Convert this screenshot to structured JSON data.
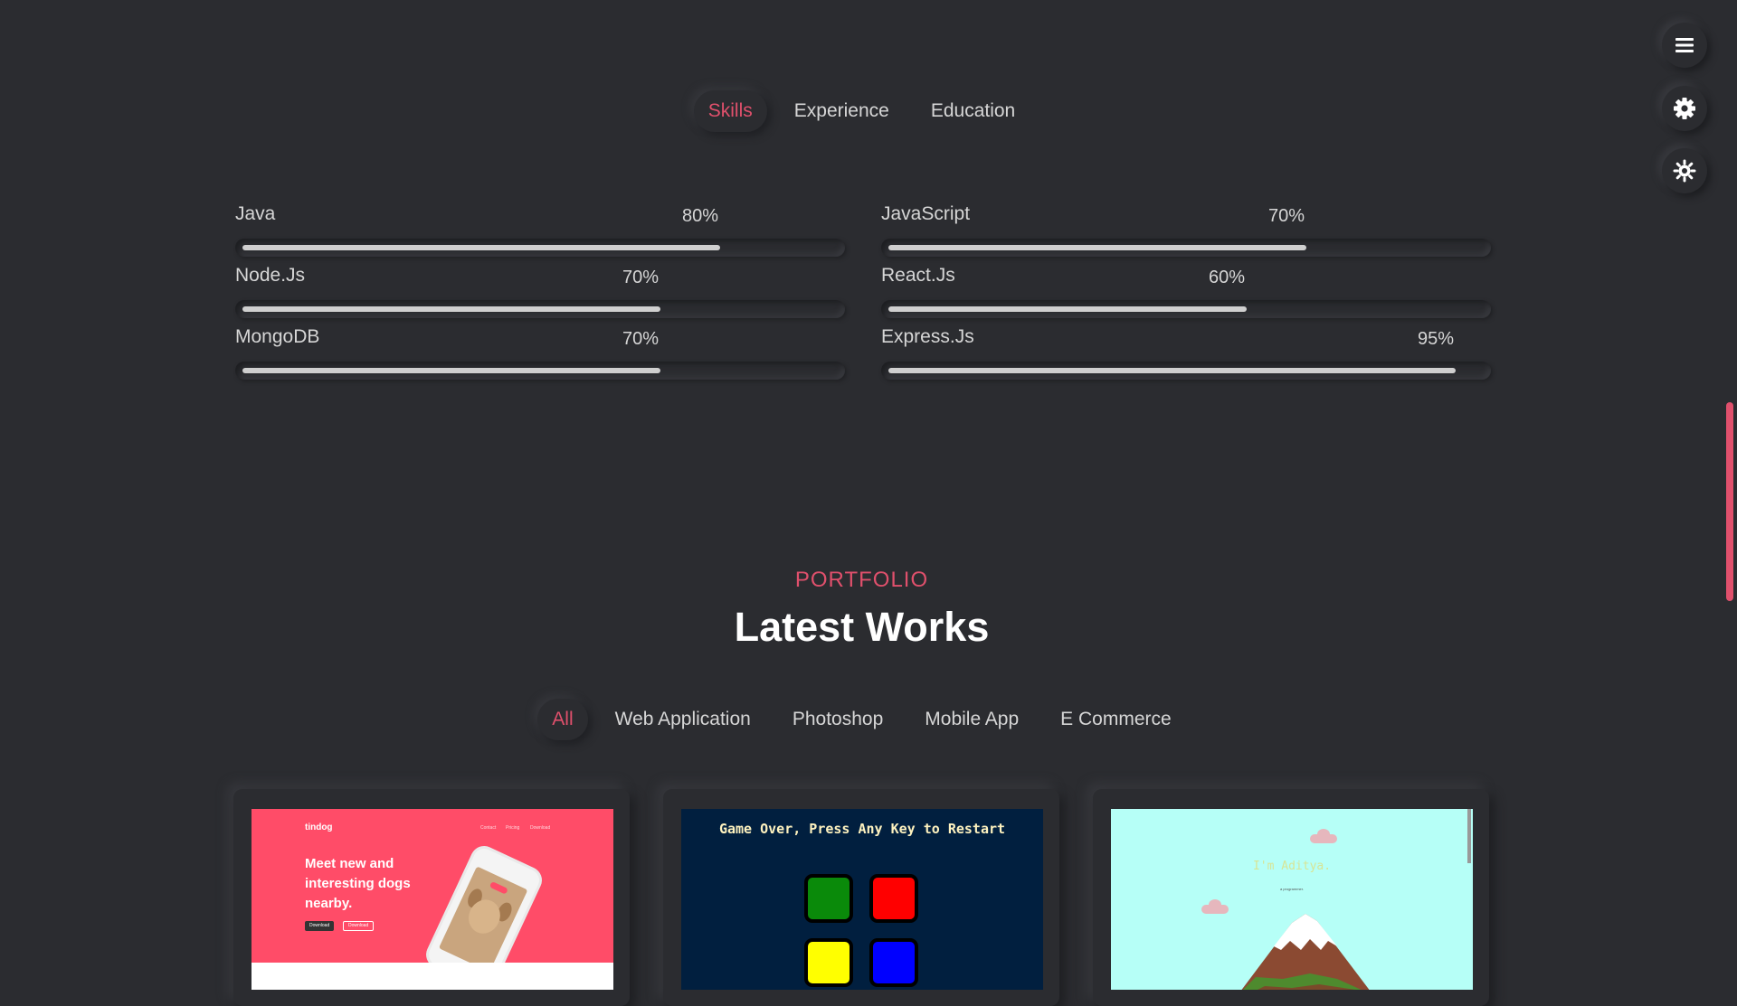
{
  "resume_tabs": [
    {
      "label": "Skills",
      "active": true
    },
    {
      "label": "Experience",
      "active": false
    },
    {
      "label": "Education",
      "active": false
    }
  ],
  "skills": [
    {
      "name": "Java",
      "percent_label": "80%",
      "level": 0.8
    },
    {
      "name": "JavaScript",
      "percent_label": "70%",
      "level": 0.7
    },
    {
      "name": "Node.Js",
      "percent_label": "70%",
      "level": 0.7
    },
    {
      "name": "React.Js",
      "percent_label": "60%",
      "level": 0.6
    },
    {
      "name": "MongoDB",
      "percent_label": "70%",
      "level": 0.7
    },
    {
      "name": "Express.Js",
      "percent_label": "95%",
      "level": 0.95
    }
  ],
  "portfolio": {
    "subtitle": "PORTFOLIO",
    "title": "Latest Works",
    "filters": [
      {
        "label": "All",
        "active": true
      },
      {
        "label": "Web Application",
        "active": false
      },
      {
        "label": "Photoshop",
        "active": false
      },
      {
        "label": "Mobile App",
        "active": false
      },
      {
        "label": "E Commerce",
        "active": false
      }
    ],
    "cards": [
      {
        "brand": "tindog",
        "nav": [
          "Contact",
          "Pricing",
          "Download"
        ],
        "headline": "Meet new and interesting dogs nearby.",
        "buttons": [
          "Download",
          "Download"
        ]
      },
      {
        "title": "Game Over, Press Any Key to Restart"
      },
      {
        "greeting": "I'm Aditya.",
        "tagline": "a programmer."
      }
    ]
  },
  "controls": {
    "menu_icon": "hamburger-icon",
    "settings_icon": "gear-icon",
    "theme_icon": "sun-icon"
  },
  "colors": {
    "background": "#2b2c30",
    "accent": "#e0506c",
    "text": "#d6d6d6"
  }
}
